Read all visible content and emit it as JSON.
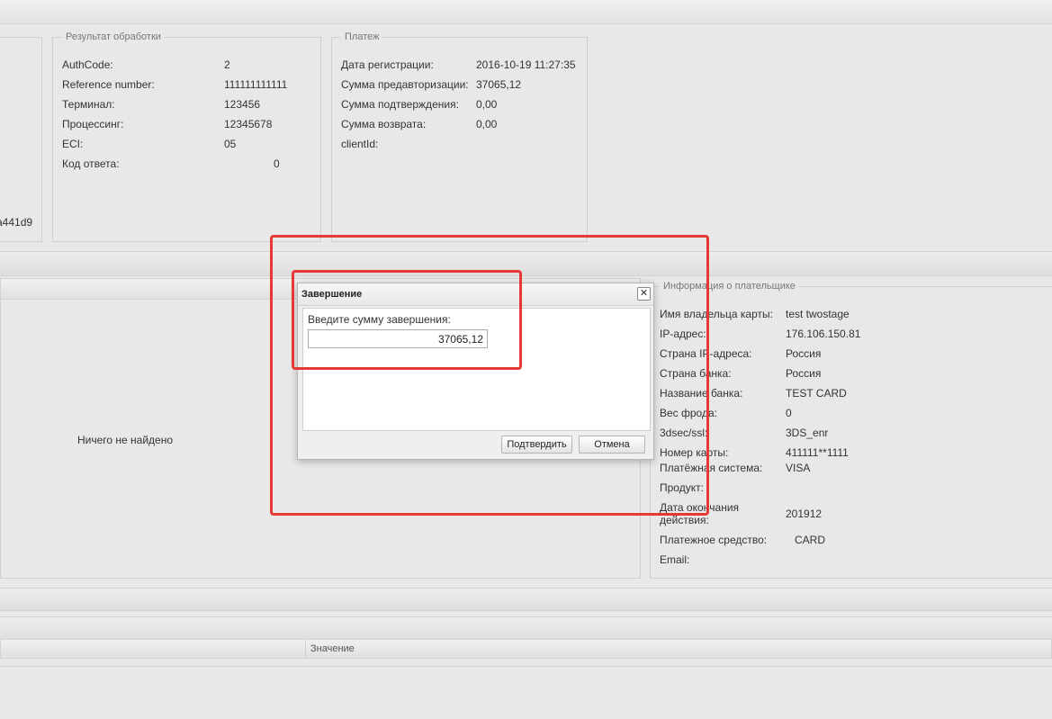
{
  "left_partial_value": "a441d9",
  "processing_result": {
    "legend": "Результат обработки",
    "rows": [
      {
        "label": "AuthCode:",
        "value": "2"
      },
      {
        "label": "Reference number:",
        "value": "111111111111"
      },
      {
        "label": "Терминал:",
        "value": "123456"
      },
      {
        "label": "Процессинг:",
        "value": "12345678"
      },
      {
        "label": "ECI:",
        "value": "05"
      },
      {
        "label": "Код ответа:",
        "value": "0"
      }
    ]
  },
  "payment": {
    "legend": "Платеж",
    "rows": [
      {
        "label": "Дата регистрации:",
        "value": "2016-10-19 11:27:35"
      },
      {
        "label": "Сумма предавторизации:",
        "value": "37065,12"
      },
      {
        "label": "Сумма подтверждения:",
        "value": "0,00"
      },
      {
        "label": "Сумма возврата:",
        "value": "0,00"
      },
      {
        "label": "clientId:",
        "value": ""
      }
    ]
  },
  "empty_list_text": "Ничего не найдено",
  "payer_info": {
    "legend": "Информация о плательщике",
    "rows": [
      {
        "label": "Имя владельца карты:",
        "value": "test twostage"
      },
      {
        "label": "IP-адрес:",
        "value": "176.106.150.81"
      },
      {
        "label": "Страна IP-адреса:",
        "value": "Россия"
      },
      {
        "label": "Страна банка:",
        "value": "Россия"
      },
      {
        "label": "Название банка:",
        "value": "TEST CARD"
      },
      {
        "label": "Вес фрода:",
        "value": "0"
      },
      {
        "label": "3dsec/ssl:",
        "value": "3DS_enr"
      },
      {
        "label": "Номер карты:",
        "value": "411111**1111"
      },
      {
        "label": "Платёжная система:",
        "value": "VISA"
      },
      {
        "label": "Продукт:",
        "value": ""
      },
      {
        "label_line1": "Дата окончания",
        "label_line2": "действия:",
        "value": "201912"
      },
      {
        "label": "Платежное средство:",
        "value": "CARD"
      },
      {
        "label": "Email:",
        "value": ""
      }
    ]
  },
  "bottom_table": {
    "columns": [
      "",
      "Значение"
    ]
  },
  "dialog": {
    "title": "Завершение",
    "close_glyph": "✕",
    "prompt": "Введите сумму завершения:",
    "amount": "37065,12",
    "confirm_label": "Подтвердить",
    "cancel_label": "Отмена"
  },
  "colors": {
    "highlight": "#e53935",
    "background": "#e8e8e8"
  }
}
